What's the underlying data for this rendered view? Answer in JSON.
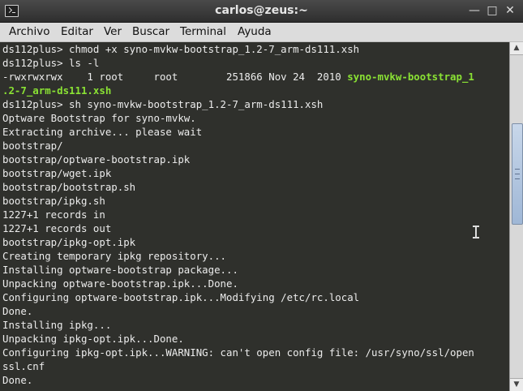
{
  "window": {
    "title": "carlos@zeus:~",
    "controls": {
      "minimize": "—",
      "maximize": "□",
      "close": "✕"
    }
  },
  "menu": {
    "items": [
      "Archivo",
      "Editar",
      "Ver",
      "Buscar",
      "Terminal",
      "Ayuda"
    ]
  },
  "terminal": {
    "lines": [
      "ds112plus> chmod +x syno-mvkw-bootstrap_1.2-7_arm-ds111.xsh",
      "ds112plus> ls -l",
      "-rwxrwxrwx    1 root     root        251866 Nov 24  2010 ",
      ".2-7_arm-ds111.xsh",
      "ds112plus> sh syno-mvkw-bootstrap_1.2-7_arm-ds111.xsh",
      "Optware Bootstrap for syno-mvkw.",
      "Extracting archive... please wait",
      "bootstrap/",
      "bootstrap/optware-bootstrap.ipk",
      "bootstrap/wget.ipk",
      "bootstrap/bootstrap.sh",
      "bootstrap/ipkg.sh",
      "1227+1 records in",
      "1227+1 records out",
      "bootstrap/ipkg-opt.ipk",
      "Creating temporary ipkg repository...",
      "Installing optware-bootstrap package...",
      "Unpacking optware-bootstrap.ipk...Done.",
      "Configuring optware-bootstrap.ipk...Modifying /etc/rc.local",
      "Done.",
      "Installing ipkg...",
      "Unpacking ipkg-opt.ipk...Done.",
      "Configuring ipkg-opt.ipk...WARNING: can't open config file: /usr/syno/ssl/open",
      "ssl.cnf",
      "Done."
    ],
    "ls_filename_part1": "syno-mvkw-bootstrap_1"
  },
  "scrollbar": {
    "up_icon": "arrow-up-icon",
    "down_icon": "arrow-down-icon",
    "thumb_position_fraction": 0.21,
    "thumb_size_fraction": 0.31
  }
}
